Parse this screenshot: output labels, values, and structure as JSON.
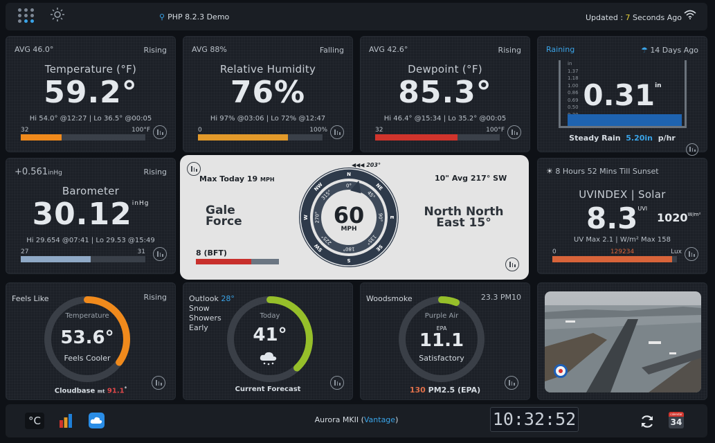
{
  "header": {
    "location": "PHP 8.2.3 Demo",
    "updated_prefix": "Updated :",
    "updated_num": "7",
    "updated_suffix": "Seconds Ago"
  },
  "temperature": {
    "avg": "AVG 46.0°",
    "trend": "Rising",
    "title": "Temperature (°F)",
    "value": "59.2°",
    "hilo": "Hi 54.0° @12:27 | Lo 36.5° @00:05",
    "min": "32",
    "max": "100°F",
    "fill": 0.33,
    "color": "#f08a1c"
  },
  "humidity": {
    "avg": "AVG 88%",
    "trend": "Falling",
    "title": "Relative Humidity",
    "value": "76%",
    "hilo": "Hi 97% @03:06 | Lo 72% @12:47",
    "min": "0",
    "max": "100%",
    "fill": 0.72,
    "color": "#e39a2a"
  },
  "dewpoint": {
    "avg": "AVG 42.6°",
    "trend": "Rising",
    "title": "Dewpoint (°F)",
    "value": "85.3°",
    "hilo": "Hi 46.4° @15:34 | Lo 35.2° @00:05",
    "min": "32",
    "max": "100°F",
    "fill": 0.66,
    "color": "#d0342c"
  },
  "rain": {
    "status": "Raining",
    "days": "14 Days Ago",
    "value": "0.31",
    "unit": "in",
    "ticks": [
      "in",
      "1.37",
      "1.18",
      "1.00",
      "0.86",
      "0.69",
      "0.50",
      "0.30",
      "0.10"
    ],
    "label": "Steady Rain",
    "rate": "5.20in",
    "rate_unit": "p/hr",
    "level": 0.18
  },
  "barometer": {
    "change": "+0.561",
    "change_unit": "inHg",
    "trend": "Rising",
    "title": "Barometer",
    "value": "30.12",
    "unit": "inHg",
    "hilo": "Hi 29.654 @07:41 | Lo 29.53 @15:49",
    "min": "27",
    "max": "31",
    "fill": 0.56,
    "color": "#8fa9c6"
  },
  "wind": {
    "max_today": "Max Today 19",
    "max_unit": "MPH",
    "force": "Gale Force",
    "bft": "8 (BFT)",
    "bft_fill": 0.67,
    "speed": "60",
    "speed_unit": "MPH",
    "avg": "10\" Avg 217° SW",
    "direction_line1": "North North",
    "direction_line2": "East 15°",
    "gust_dir": "◀◀◀ 203°",
    "compass": [
      "N",
      "NE",
      "E",
      "SE",
      "S",
      "SW",
      "W",
      "NW"
    ],
    "degrees": [
      "0°",
      "45°",
      "90°",
      "135°",
      "180°",
      "225°",
      "270°",
      "315°"
    ],
    "heading": 15
  },
  "uv": {
    "sunset": "8 Hours 52 Mins Till Sunset",
    "title": "UVINDEX | Solar",
    "value": "8.3",
    "uvi": "UVI",
    "solar": "1020",
    "solar_unit": "W/m²",
    "max": "UV Max 2.1 | W/m² Max 158",
    "min": "0",
    "bar_value": "129234",
    "max_label": "Lux",
    "fill": 0.96,
    "color": "#d8643a"
  },
  "feels": {
    "label": "Feels Like",
    "trend": "Rising",
    "inner_title": "Temperature",
    "value": "53.6°",
    "desc": "Feels Cooler",
    "cloud_label": "Cloudbase",
    "cloud_unit": "mt",
    "cloud_value": "91.1",
    "cloud_sup": "*",
    "arc": 0.35,
    "color": "#f08a1c"
  },
  "forecast": {
    "outlook": "Outlook",
    "outlook_temp": "28°",
    "line1": "Snow",
    "line2": "Showers",
    "line3": "Early",
    "inner_title": "Today",
    "value": "41°",
    "footer": "Current Forecast",
    "arc": 0.38,
    "color": "#96bf2a"
  },
  "aqi": {
    "label": "Woodsmoke",
    "pm": "23.3 PM10",
    "inner_title": "Purple Air",
    "epa": "EPA",
    "value": "11.1",
    "desc": "Satisfactory",
    "pm25_value": "130",
    "pm25_label": "PM2.5 (EPA)",
    "arc": 0.06,
    "color": "#96bf2a"
  },
  "footer": {
    "celsius": "°C",
    "station_prefix": "Aurora MKII (",
    "station_link": "Vantage",
    "station_suffix": ")",
    "clock": "10:32:52",
    "cal_top": "calendar",
    "cal_day": "34"
  }
}
